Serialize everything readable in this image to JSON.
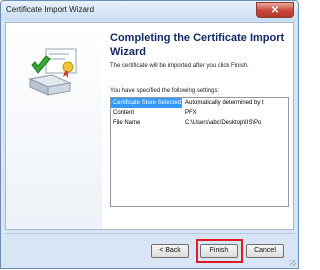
{
  "window": {
    "title": "Certificate Import Wizard",
    "close_icon": "close-icon"
  },
  "wizard": {
    "heading": "Completing the Certificate Import Wizard",
    "subtitle": "The certificate will be imported after you click Finish.",
    "settings_label": "You have specified the following settings:",
    "settings": [
      {
        "key": "Certificate Store Selected",
        "value": "Automatically determined by t"
      },
      {
        "key": "Content",
        "value": "PFX"
      },
      {
        "key": "File Name",
        "value": "C:\\Users\\abc\\Desktop\\IIS\\Po"
      }
    ]
  },
  "buttons": {
    "back": "< Back",
    "finish": "Finish",
    "cancel": "Cancel"
  },
  "colors": {
    "selection": "#3399ff",
    "heading": "#102b66",
    "highlight": "#e11b22"
  }
}
